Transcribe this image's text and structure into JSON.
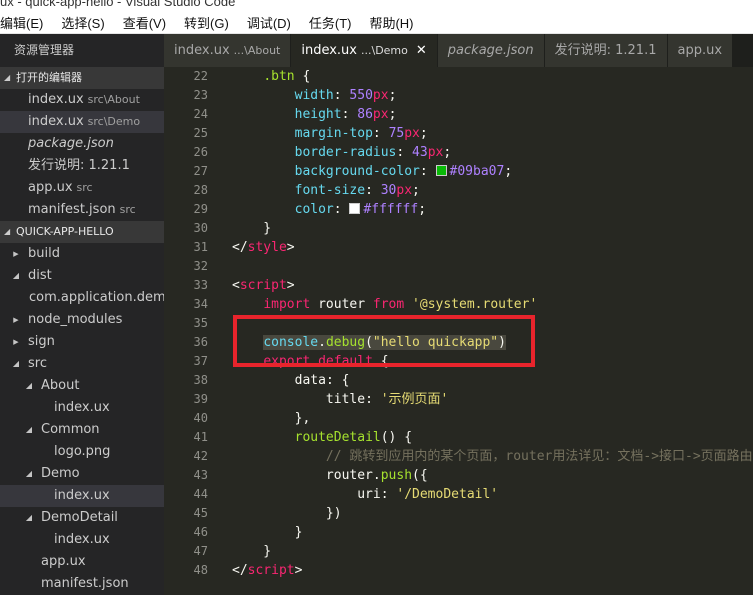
{
  "window": {
    "title": "ux - quick-app-hello - Visual Studio Code"
  },
  "menu": [
    "编辑(E)",
    "选择(S)",
    "查看(V)",
    "转到(G)",
    "调试(D)",
    "任务(T)",
    "帮助(H)"
  ],
  "sidebar": {
    "title": "资源管理器",
    "open_editors_label": "打开的编辑器",
    "open_editors": [
      {
        "name": "index.ux",
        "desc": "src\\About",
        "italic": false,
        "active": false
      },
      {
        "name": "index.ux",
        "desc": "src\\Demo",
        "italic": false,
        "active": true
      },
      {
        "name": "package.json",
        "desc": "",
        "italic": true,
        "active": false
      },
      {
        "name": "发行说明: 1.21.1",
        "desc": "",
        "italic": false,
        "active": false
      },
      {
        "name": "app.ux",
        "desc": "src",
        "italic": false,
        "active": false
      },
      {
        "name": "manifest.json",
        "desc": "src",
        "italic": false,
        "active": false
      }
    ],
    "project_label": "QUICK-APP-HELLO",
    "tree": [
      {
        "name": "build",
        "indent": 0,
        "caret": "r",
        "active": false
      },
      {
        "name": "dist",
        "indent": 0,
        "caret": "d",
        "active": false
      },
      {
        "name": "com.application.dem...",
        "indent": 1,
        "caret": "",
        "active": false
      },
      {
        "name": "node_modules",
        "indent": 0,
        "caret": "r",
        "active": false
      },
      {
        "name": "sign",
        "indent": 0,
        "caret": "r",
        "active": false
      },
      {
        "name": "src",
        "indent": 0,
        "caret": "d",
        "active": false
      },
      {
        "name": "About",
        "indent": 1,
        "caret": "d",
        "active": false
      },
      {
        "name": "index.ux",
        "indent": 2,
        "caret": "",
        "active": false
      },
      {
        "name": "Common",
        "indent": 1,
        "caret": "d",
        "active": false
      },
      {
        "name": "logo.png",
        "indent": 2,
        "caret": "",
        "active": false
      },
      {
        "name": "Demo",
        "indent": 1,
        "caret": "d",
        "active": false
      },
      {
        "name": "index.ux",
        "indent": 2,
        "caret": "",
        "active": true
      },
      {
        "name": "DemoDetail",
        "indent": 1,
        "caret": "d",
        "active": false
      },
      {
        "name": "index.ux",
        "indent": 2,
        "caret": "",
        "active": false
      },
      {
        "name": "app.ux",
        "indent": 1,
        "caret": "",
        "active": false
      },
      {
        "name": "manifest.json",
        "indent": 1,
        "caret": "",
        "active": false
      }
    ]
  },
  "tabs": [
    {
      "name": "index.ux",
      "desc": "...\\About",
      "italic": false,
      "active": false,
      "close": ""
    },
    {
      "name": "index.ux",
      "desc": "...\\Demo",
      "italic": false,
      "active": true,
      "close": "✕"
    },
    {
      "name": "package.json",
      "desc": "",
      "italic": true,
      "active": false,
      "close": ""
    },
    {
      "name": "发行说明: 1.21.1",
      "desc": "",
      "italic": false,
      "active": false,
      "close": ""
    },
    {
      "name": "app.ux",
      "desc": "",
      "italic": false,
      "active": false,
      "close": ""
    }
  ],
  "editor": {
    "line_numbers": [
      "22",
      "23",
      "24",
      "25",
      "26",
      "27",
      "28",
      "29",
      "30",
      "31",
      "32",
      "33",
      "34",
      "35",
      "36",
      "37",
      "38",
      "39",
      "40",
      "41",
      "42",
      "43",
      "44",
      "45",
      "46",
      "47",
      "48"
    ],
    "colors": {
      "green_swatch": "#09ba07",
      "white_swatch": "#ffffff",
      "highlight_border": "#e8242c"
    },
    "lines": [
      [
        {
          "t": "    ",
          "c": "pun"
        },
        {
          "t": ".btn",
          "c": "sel"
        },
        {
          "t": " {",
          "c": "pun"
        }
      ],
      [
        {
          "t": "        ",
          "c": "pun"
        },
        {
          "t": "width",
          "c": "prop"
        },
        {
          "t": ": ",
          "c": "pun"
        },
        {
          "t": "550",
          "c": "num"
        },
        {
          "t": "px",
          "c": "unit"
        },
        {
          "t": ";",
          "c": "pun"
        }
      ],
      [
        {
          "t": "        ",
          "c": "pun"
        },
        {
          "t": "height",
          "c": "prop"
        },
        {
          "t": ": ",
          "c": "pun"
        },
        {
          "t": "86",
          "c": "num"
        },
        {
          "t": "px",
          "c": "unit"
        },
        {
          "t": ";",
          "c": "pun"
        }
      ],
      [
        {
          "t": "        ",
          "c": "pun"
        },
        {
          "t": "margin-top",
          "c": "prop"
        },
        {
          "t": ": ",
          "c": "pun"
        },
        {
          "t": "75",
          "c": "num"
        },
        {
          "t": "px",
          "c": "unit"
        },
        {
          "t": ";",
          "c": "pun"
        }
      ],
      [
        {
          "t": "        ",
          "c": "pun"
        },
        {
          "t": "border-radius",
          "c": "prop"
        },
        {
          "t": ": ",
          "c": "pun"
        },
        {
          "t": "43",
          "c": "num"
        },
        {
          "t": "px",
          "c": "unit"
        },
        {
          "t": ";",
          "c": "pun"
        }
      ],
      [
        {
          "t": "        ",
          "c": "pun"
        },
        {
          "t": "background-color",
          "c": "prop"
        },
        {
          "t": ": ",
          "c": "pun"
        },
        {
          "t": "",
          "c": "swatch",
          "color": "#09ba07"
        },
        {
          "t": "#09ba07",
          "c": "num"
        },
        {
          "t": ";",
          "c": "pun"
        }
      ],
      [
        {
          "t": "        ",
          "c": "pun"
        },
        {
          "t": "font-size",
          "c": "prop"
        },
        {
          "t": ": ",
          "c": "pun"
        },
        {
          "t": "30",
          "c": "num"
        },
        {
          "t": "px",
          "c": "unit"
        },
        {
          "t": ";",
          "c": "pun"
        }
      ],
      [
        {
          "t": "        ",
          "c": "pun"
        },
        {
          "t": "color",
          "c": "prop"
        },
        {
          "t": ": ",
          "c": "pun"
        },
        {
          "t": "",
          "c": "swatch",
          "color": "#ffffff"
        },
        {
          "t": "#ffffff",
          "c": "num"
        },
        {
          "t": ";",
          "c": "pun"
        }
      ],
      [
        {
          "t": "    }",
          "c": "pun"
        }
      ],
      [
        {
          "t": "</",
          "c": "pun"
        },
        {
          "t": "style",
          "c": "tag"
        },
        {
          "t": ">",
          "c": "pun"
        }
      ],
      [],
      [
        {
          "t": "<",
          "c": "pun"
        },
        {
          "t": "script",
          "c": "tag"
        },
        {
          "t": ">",
          "c": "pun"
        }
      ],
      [
        {
          "t": "    ",
          "c": "pun"
        },
        {
          "t": "import",
          "c": "kw"
        },
        {
          "t": " router ",
          "c": "id"
        },
        {
          "t": "from",
          "c": "kw"
        },
        {
          "t": " ",
          "c": "pun"
        },
        {
          "t": "'@system.router'",
          "c": "str"
        }
      ],
      [],
      [
        {
          "t": "    ",
          "c": "pun"
        },
        {
          "t": "console",
          "c": "obj",
          "hl": true
        },
        {
          "t": ".",
          "c": "pun",
          "hl": true
        },
        {
          "t": "debug",
          "c": "fn",
          "hl": true
        },
        {
          "t": "(",
          "c": "pun",
          "hl": true
        },
        {
          "t": "\"hello quickapp\"",
          "c": "str",
          "hl": true
        },
        {
          "t": ")",
          "c": "pun",
          "hl": true
        }
      ],
      [
        {
          "t": "    ",
          "c": "pun"
        },
        {
          "t": "export",
          "c": "kw"
        },
        {
          "t": " ",
          "c": "pun"
        },
        {
          "t": "default",
          "c": "kw"
        },
        {
          "t": " {",
          "c": "pun"
        }
      ],
      [
        {
          "t": "        ",
          "c": "pun"
        },
        {
          "t": "data",
          "c": "id"
        },
        {
          "t": ": {",
          "c": "pun"
        }
      ],
      [
        {
          "t": "            ",
          "c": "pun"
        },
        {
          "t": "title",
          "c": "id"
        },
        {
          "t": ": ",
          "c": "pun"
        },
        {
          "t": "'示例页面'",
          "c": "str"
        }
      ],
      [
        {
          "t": "        },",
          "c": "pun"
        }
      ],
      [
        {
          "t": "        ",
          "c": "pun"
        },
        {
          "t": "routeDetail",
          "c": "fn"
        },
        {
          "t": "() {",
          "c": "pun"
        }
      ],
      [
        {
          "t": "            ",
          "c": "pun"
        },
        {
          "t": "// 跳转到应用内的某个页面，router用法详见：文档->接口->页面路由",
          "c": "com"
        }
      ],
      [
        {
          "t": "            ",
          "c": "pun"
        },
        {
          "t": "router",
          "c": "id"
        },
        {
          "t": ".",
          "c": "pun"
        },
        {
          "t": "push",
          "c": "fn"
        },
        {
          "t": "({",
          "c": "pun"
        }
      ],
      [
        {
          "t": "                ",
          "c": "pun"
        },
        {
          "t": "uri",
          "c": "id"
        },
        {
          "t": ": ",
          "c": "pun"
        },
        {
          "t": "'/DemoDetail'",
          "c": "str"
        }
      ],
      [
        {
          "t": "            })",
          "c": "pun"
        }
      ],
      [
        {
          "t": "        }",
          "c": "pun"
        }
      ],
      [
        {
          "t": "    }",
          "c": "pun"
        }
      ],
      [
        {
          "t": "</",
          "c": "pun"
        },
        {
          "t": "script",
          "c": "tag"
        },
        {
          "t": ">",
          "c": "pun"
        }
      ]
    ]
  }
}
